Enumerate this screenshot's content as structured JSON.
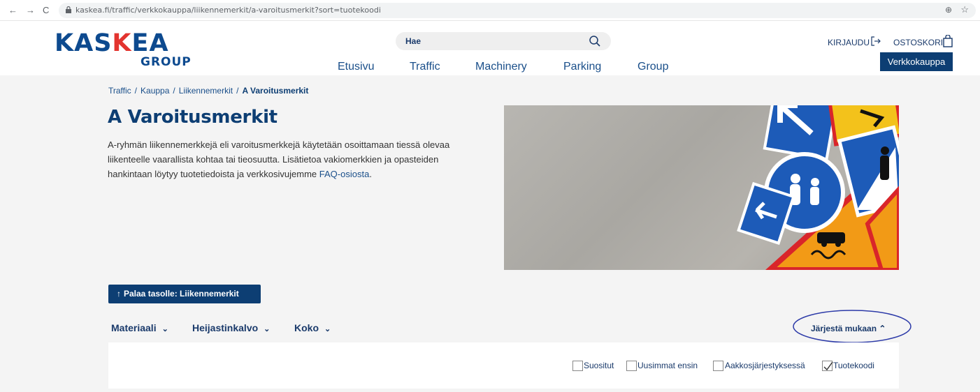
{
  "browser": {
    "url": "kaskea.fi/traffic/verkkokauppa/liikennemerkit/a-varoitusmerkit?sort=tuotekoodi",
    "back": "←",
    "forward": "→",
    "reload": "C"
  },
  "logo": {
    "text_a": "KAS",
    "text_b": "K",
    "text_c": "EA",
    "sub": "GROUP"
  },
  "search": {
    "placeholder": "Hae"
  },
  "account": {
    "login": "KIRJAUDU",
    "cart": "OSTOSKORI",
    "shop": "Verkkokauppa"
  },
  "nav": [
    "Etusivu",
    "Traffic",
    "Machinery",
    "Parking",
    "Group"
  ],
  "breadcrumb": [
    "Traffic",
    "Kauppa",
    "Liikennemerkit",
    "A Varoitusmerkit"
  ],
  "page": {
    "title": "A Varoitusmerkit",
    "intro_line1": "A-ryhmän liikennemerkkejä eli varoitusmerkkejä käytetään osoittamaan tiessä olevaa",
    "intro_line2": "liikenteelle vaarallista kohtaa tai tieosuutta. Lisätietoa vakiomerkkien ja opasteiden",
    "intro_line3": "hankintaan löytyy tuotetiedoista ja verkkosivujemme",
    "intro_link": "FAQ-osiosta",
    "intro_end": "."
  },
  "back_button": "Palaa tasolle: Liikennemerkit",
  "filters": [
    "Materiaali",
    "Heijastinkalvo",
    "Koko"
  ],
  "sort": {
    "toggle": "Järjestä mukaan",
    "options": [
      {
        "label": "Suositut",
        "checked": false
      },
      {
        "label": "Uusimmat ensin",
        "checked": false
      },
      {
        "label": "Aakkosjärjestyksessä",
        "checked": false
      },
      {
        "label": "Tuotekoodi",
        "checked": true
      }
    ]
  },
  "colors": {
    "brand": "#0d3e73",
    "accent": "#e3342f",
    "link": "#1a4f8a"
  }
}
